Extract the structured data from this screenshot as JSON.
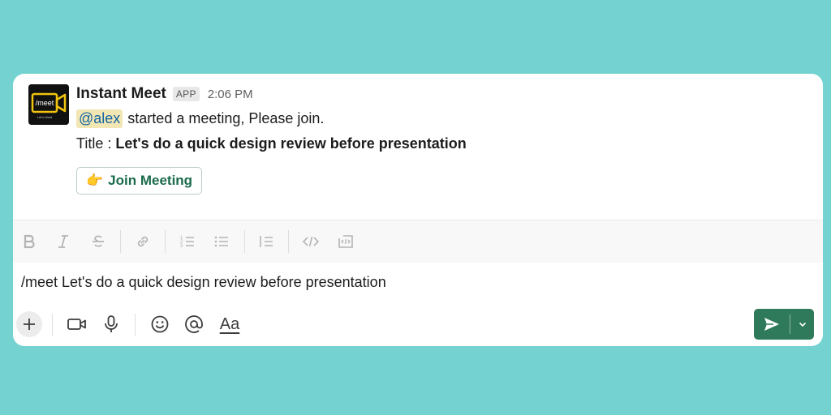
{
  "message": {
    "sender": "Instant Meet",
    "badge": "APP",
    "time": "2:06 PM",
    "avatar_text": "/meet",
    "avatar_subtext": "Let's Meet",
    "mention": "@alex",
    "body": "started a meeting, Please join.",
    "title_label": "Title :",
    "title_value": "Let's do a quick design review before presentation",
    "join_emoji": "👉",
    "join_label": "Join Meeting"
  },
  "composer": {
    "input_text": "/meet Let's do a quick design review before presentation",
    "format_text_label": "Aa"
  },
  "colors": {
    "background": "#74d3d1",
    "mention_bg": "#f2e6b4",
    "mention_text": "#1264a3",
    "send_button": "#2f7a5a",
    "join_text": "#1a6b4c",
    "avatar_accent": "#f1c40f"
  },
  "icons": {
    "toolbar": [
      "bold-icon",
      "italic-icon",
      "strikethrough-icon",
      "link-icon",
      "ordered-list-icon",
      "bulleted-list-icon",
      "blockquote-icon",
      "code-icon",
      "code-block-icon"
    ],
    "bottom": [
      "plus-icon",
      "video-icon",
      "microphone-icon",
      "emoji-icon",
      "mention-icon",
      "format-text-icon",
      "send-icon",
      "chevron-down-icon"
    ]
  }
}
